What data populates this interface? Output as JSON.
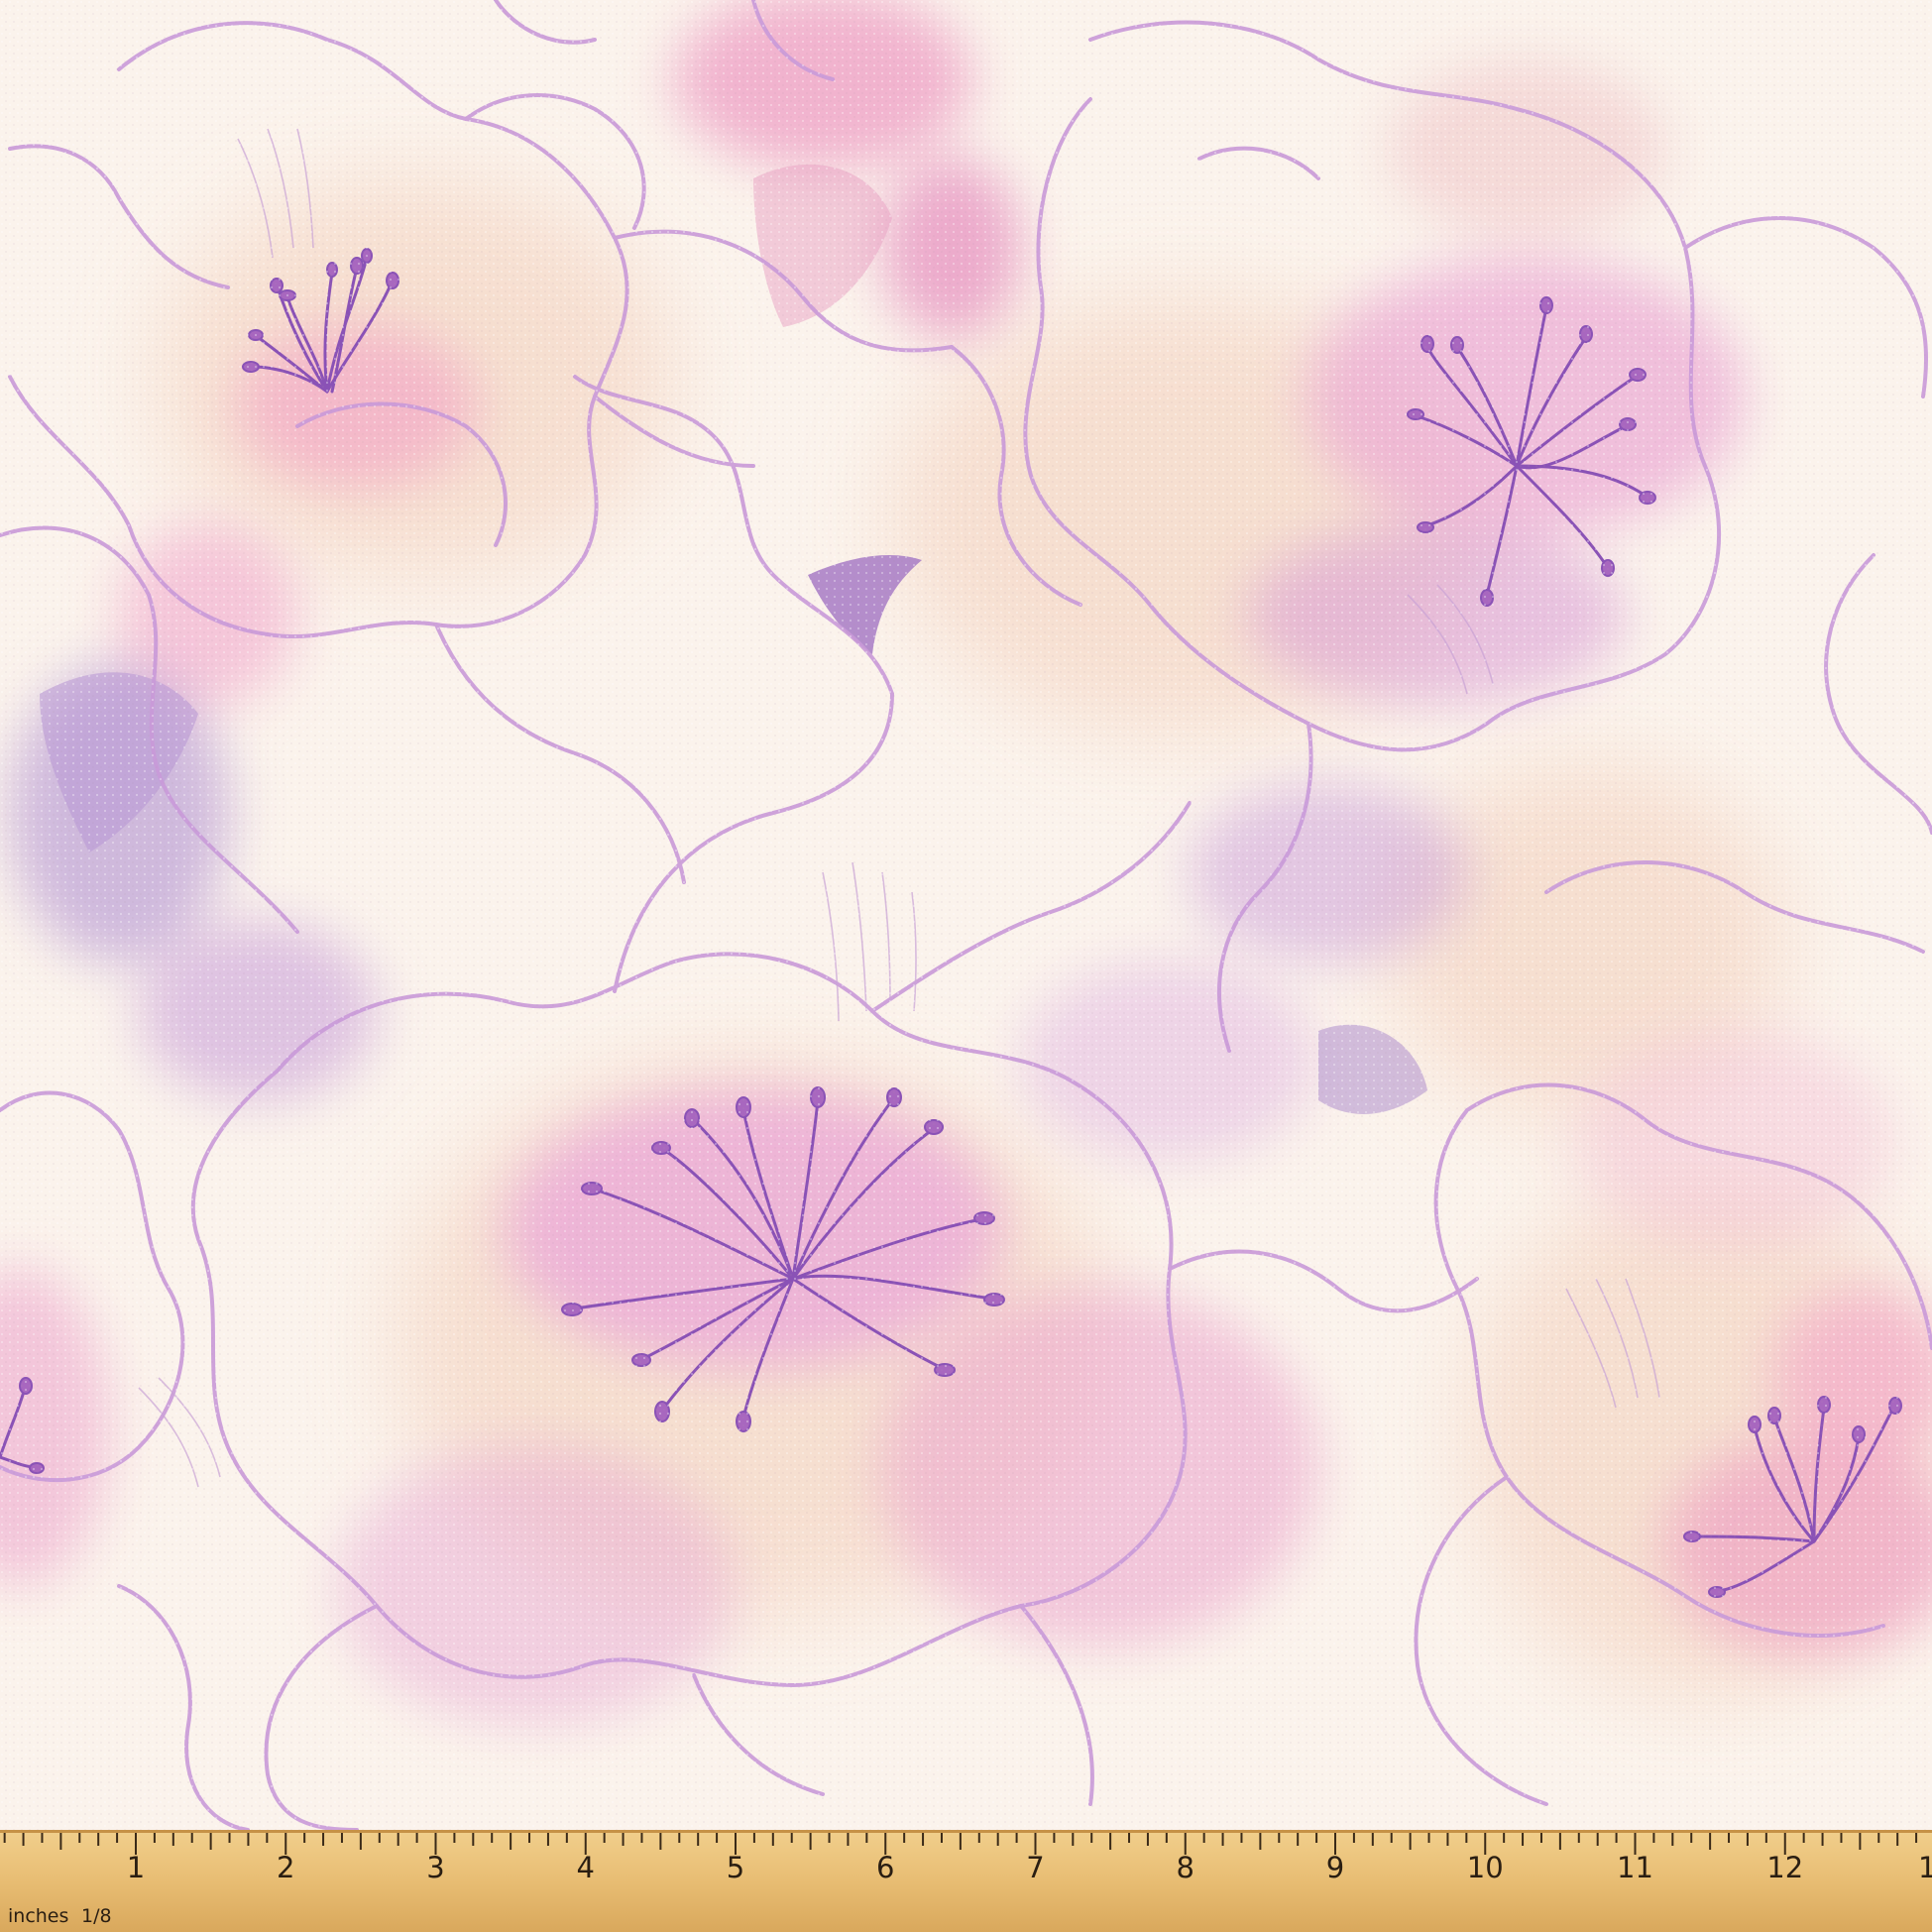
{
  "ruler": {
    "unit_label": "inches",
    "fraction_label": "1/8",
    "numbers": [
      "1",
      "2",
      "3",
      "4",
      "5",
      "6",
      "7",
      "8",
      "9",
      "10",
      "11",
      "12",
      "1"
    ]
  },
  "fabric": {
    "pattern": "watercolor flowers",
    "colors": {
      "base": "#fbf3ec",
      "blush": "#f6dccc",
      "pink": "#f3b8d6",
      "lilac": "#d7a4db",
      "violet": "#b885cf",
      "outline": "#c99ad9",
      "stamen": "#8a52b6"
    }
  }
}
